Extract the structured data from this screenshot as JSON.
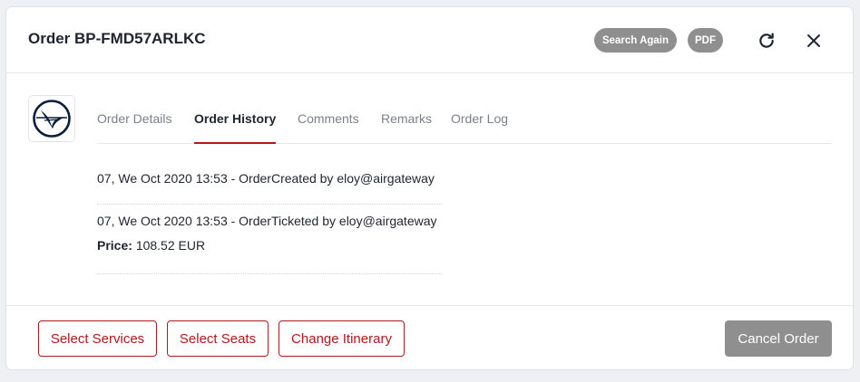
{
  "modal": {
    "title": "Order BP-FMD57ARLKC",
    "search_again_label": "Search Again",
    "pdf_label": "PDF",
    "refresh_icon": "refresh-icon",
    "close_icon": "close-icon"
  },
  "airline": {
    "logo_icon": "airline-crane-logo",
    "logo_color": "#0a1d3d"
  },
  "tabs": [
    {
      "label": "Order Details",
      "active": false
    },
    {
      "label": "Order History",
      "active": true
    },
    {
      "label": "Comments",
      "active": false
    },
    {
      "label": "Remarks",
      "active": false
    },
    {
      "label": "Order Log",
      "active": false
    }
  ],
  "history": [
    {
      "text": "07, We Oct 2020 13:53 - OrderCreated by eloy@airgateway"
    },
    {
      "text": "07, We Oct 2020 13:53 - OrderTicketed by eloy@airgateway",
      "price_label": "Price:",
      "price_value": "108.52 EUR"
    }
  ],
  "footer": {
    "select_services_label": "Select Services",
    "select_seats_label": "Select Seats",
    "change_itinerary_label": "Change Itinerary",
    "cancel_order_label": "Cancel Order"
  },
  "colors": {
    "accent": "#b5161c",
    "disabled_button": "#8f8f8f",
    "text": "#1f2430",
    "muted_text": "#7b8089"
  }
}
